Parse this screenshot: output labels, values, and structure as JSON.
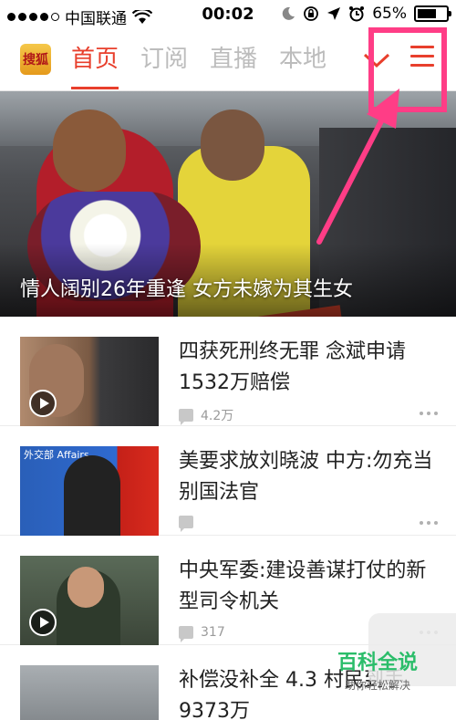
{
  "status_bar": {
    "carrier": "中国联通",
    "time": "00:02",
    "battery_percent": "65%",
    "battery_level": 0.65
  },
  "nav": {
    "logo_text": "搜狐",
    "tabs": [
      {
        "label": "首页",
        "active": true
      },
      {
        "label": "订阅",
        "active": false
      },
      {
        "label": "直播",
        "active": false
      },
      {
        "label": "本地",
        "active": false
      }
    ],
    "accent_color": "#e83f2c"
  },
  "hero": {
    "caption": "情人阔别26年重逢 女方未嫁为其生女"
  },
  "news": [
    {
      "title": "四获死刑终无罪 念斌申请1532万赔偿",
      "comments": "4.2万",
      "video": true
    },
    {
      "title": "美要求放刘晓波 中方:勿充当别国法官",
      "comments": "",
      "video": false,
      "thumb_text": "外交部 Affairs"
    },
    {
      "title": "中央军委:建设善谋打仗的新型司令机关",
      "comments": "317",
      "video": true
    },
    {
      "title": "补偿没补全 4.3 村民到手9373万",
      "comments": "",
      "video": false
    }
  ],
  "watermark": {
    "title": "百科全说",
    "subtitle": "助你轻松解决"
  },
  "annotation_color": "#ff3d86"
}
